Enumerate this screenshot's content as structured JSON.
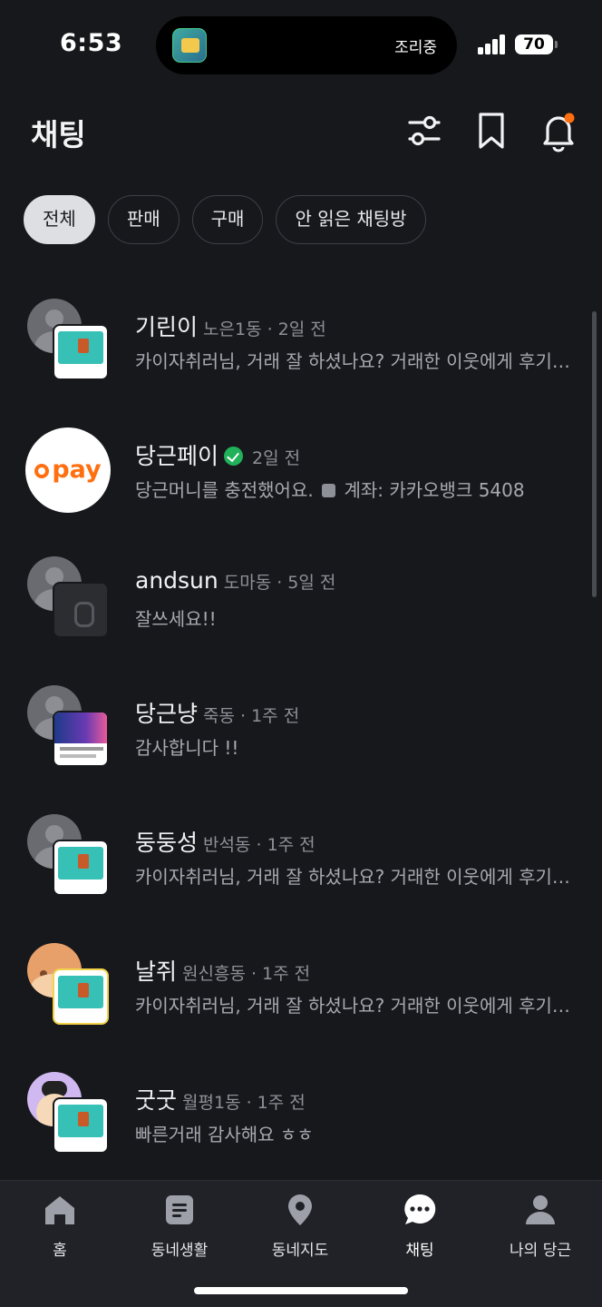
{
  "status": {
    "time": "6:53",
    "island_text": "조리중",
    "battery": "70"
  },
  "header": {
    "title": "채팅"
  },
  "filters": [
    {
      "label": "전체",
      "active": true
    },
    {
      "label": "판매"
    },
    {
      "label": "구매"
    },
    {
      "label": "안 읽은 채팅방"
    }
  ],
  "chats": [
    {
      "name": "기린이",
      "meta": "노은1동 · 2일 전",
      "message": "카이자취러님, 거래 잘 하셨나요? 거래한 이웃에게 후기를 남겨주세요",
      "avatar": "default-avatar",
      "thumb": "gift-card"
    },
    {
      "name": "당근페이",
      "meta": "2일 전",
      "message_a": "당근머니를 충전했어요.",
      "message_b": "계좌: 카카오뱅크 5408",
      "avatar": "pay-logo",
      "logo_text": "pay",
      "verified": true
    },
    {
      "name": "andsun",
      "meta": "도마동 · 5일 전",
      "message": "잘쓰세요!!",
      "avatar": "default-avatar",
      "thumb": "placeholder"
    },
    {
      "name": "당근냥",
      "meta": "죽동 · 1주 전",
      "message": "감사합니다 !!",
      "avatar": "default-avatar",
      "thumb": "promo"
    },
    {
      "name": "둥둥성",
      "meta": "반석동 · 1주 전",
      "message": "카이자취러님, 거래 잘 하셨나요? 거래한 이웃에게 후기를 남겨주세요",
      "avatar": "default-avatar",
      "thumb": "gift-card"
    },
    {
      "name": "날쥐",
      "meta": "원신흥동 · 1주 전",
      "message": "카이자취러님, 거래 잘 하셨나요? 거래한 이웃에게 후기를 남겨주세요",
      "avatar": "cartoon",
      "thumb": "gift-card"
    },
    {
      "name": "굿굿",
      "meta": "월평1동 · 1주 전",
      "message": "빠른거래 감사해요 ㅎㅎ",
      "avatar": "cartoon",
      "thumb": "gift-card"
    }
  ],
  "tabs": [
    {
      "label": "홈",
      "icon": "home-icon"
    },
    {
      "label": "동네생활",
      "icon": "board-icon"
    },
    {
      "label": "동네지도",
      "icon": "map-pin-icon"
    },
    {
      "label": "채팅",
      "icon": "chat-icon",
      "active": true
    },
    {
      "label": "나의 당근",
      "icon": "person-icon"
    }
  ],
  "colors": {
    "background": "#17181c",
    "accent": "#ff6f0f",
    "verified": "#20b15a"
  }
}
